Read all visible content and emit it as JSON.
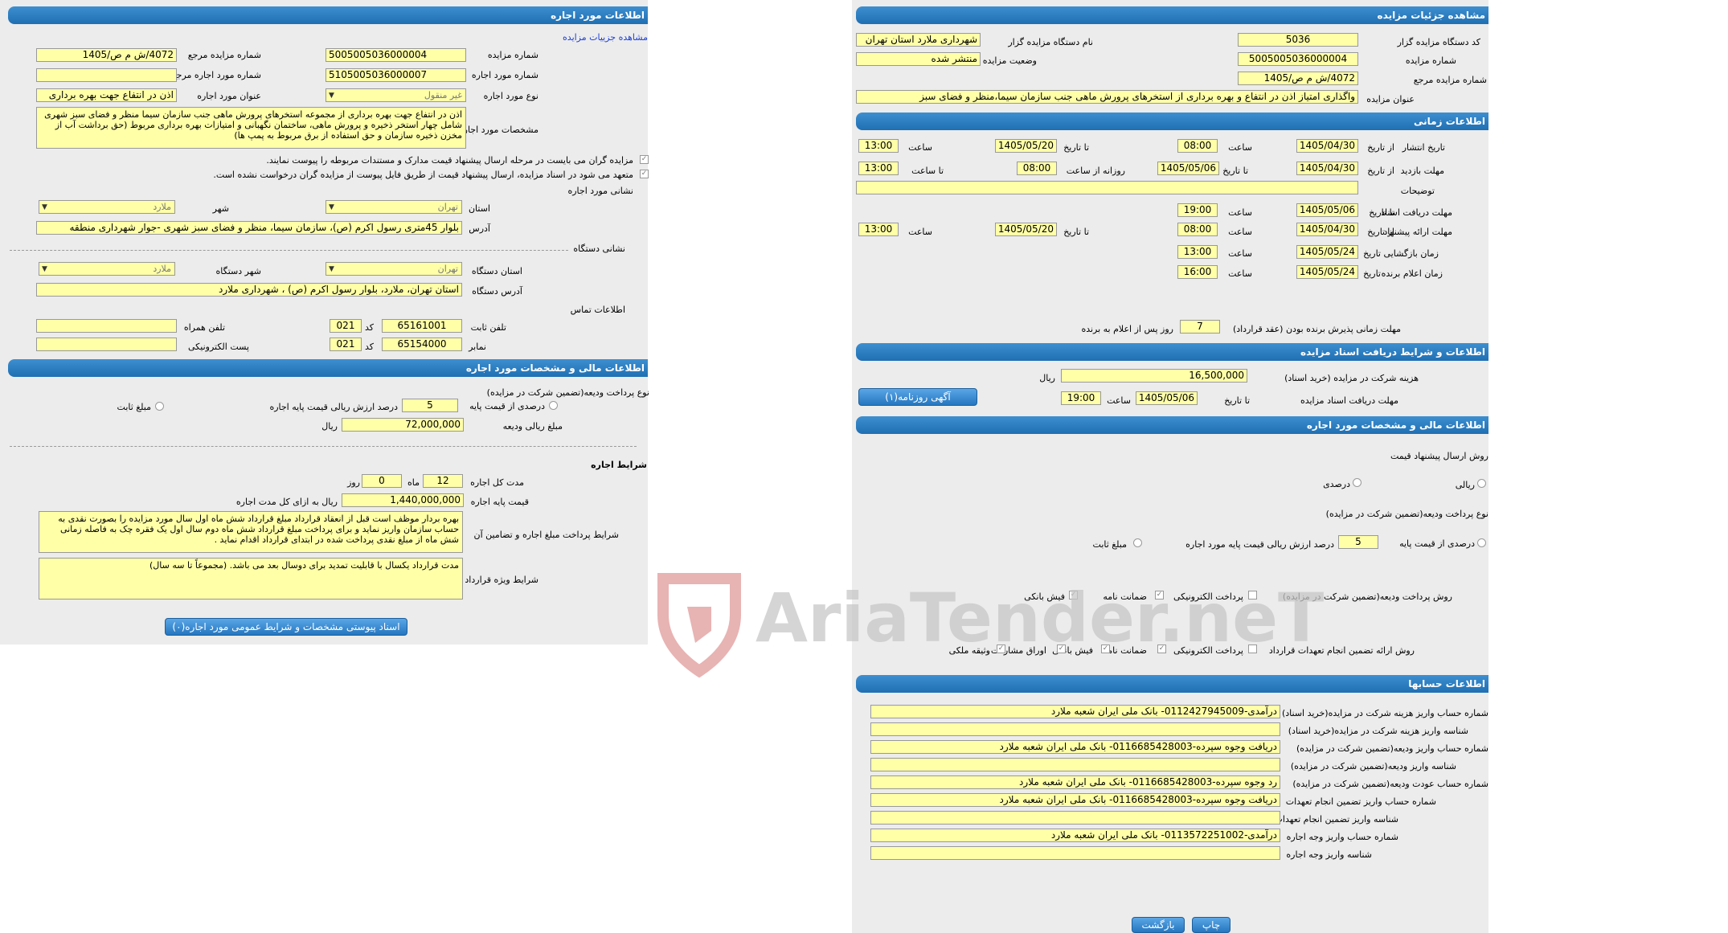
{
  "left": {
    "header": "اطلاعات مورد اجاره",
    "view_details_link": "مشاهده جزییات مزایده",
    "auction_number": {
      "label": "شماره مزایده",
      "value": "5005005036000004"
    },
    "auction_ref_number": {
      "label": "شماره مزایده مرجع",
      "value": "4072/ش م ص/1405"
    },
    "lease_item_number": {
      "label": "شماره مورد اجاره",
      "value": "5105005036000007"
    },
    "lease_ref_number": {
      "label": "شماره مورد اجاره مرجع",
      "value": ""
    },
    "item_type": {
      "label": "نوع مورد اجاره",
      "value": "غیر منقول"
    },
    "item_title": {
      "label": "عنوان مورد اجاره",
      "value": "اذن در انتفاع جهت بهره برداری"
    },
    "item_specs": {
      "label": "مشخصات مورد اجاره",
      "value": "اذن در انتفاع جهت بهره برداری از مجموعه استخرهای پرورش ماهی جنب سازمان سیما منظر و فضای سبز شهری شامل چهار استخر ذخیره و پرورش ماهی، ساختمان نگهبانی و امتیازات بهره برداری مربوط (حق برداشت آب از مخزن ذخیره سازمان و حق استفاده از برق مربوط به پمپ ها)"
    },
    "note1": "مزایده گران می بایست در مرحله ارسال پیشنهاد قیمت مدارک و مستندات مربوطه را پیوست نمایند.",
    "note2": "متعهد می شود در اسناد مزایده، ارسال پیشنهاد قیمت از طریق فایل پیوست از مزایده گران درخواست نشده است.",
    "item_address_title": "نشانی مورد اجاره",
    "province": {
      "label": "استان",
      "value": "تهران"
    },
    "city": {
      "label": "شهر",
      "value": "ملارد"
    },
    "address": {
      "label": "آدرس",
      "value": "بلوار 45متری رسول اکرم (ص)، سازمان سیما، منظر و فضای سبز شهری -جوار شهرداری منطقه"
    },
    "org_address_title": "نشانی دستگاه",
    "org_province": {
      "label": "استان دستگاه",
      "value": "تهران"
    },
    "org_city": {
      "label": "شهر دستگاه",
      "value": "ملارد"
    },
    "org_address": {
      "label": "آدرس دستگاه",
      "value": "استان تهران، ملارد، بلوار رسول اکرم (ص) ، شهرداری ملارد"
    },
    "contact_title": "اطلاعات تماس",
    "phone": {
      "label": "تلفن ثابت",
      "value": "65161001",
      "code_label": "کد",
      "code": "021"
    },
    "mobile": {
      "label": "تلفن همراه",
      "value": ""
    },
    "fax": {
      "label": "نمابر",
      "value": "65154000",
      "code_label": "کد",
      "code": "021"
    },
    "email": {
      "label": "پست الکترونیکی",
      "value": ""
    },
    "financial_header": "اطلاعات مالی و مشخصات مورد اجاره",
    "deposit_method_label": "نوع پرداخت ودیعه(تضمین شرکت در مزایده)",
    "percent_option": "درصدی از قیمت پایه",
    "percent_value": "5",
    "percent_suffix": "درصد ارزش ریالی قیمت پایه اجاره",
    "fixed_option": "مبلغ ثابت",
    "deposit_amount": {
      "label": "مبلغ ریالی ودیعه",
      "value": "72,000,000",
      "unit": "ریال"
    },
    "lease_terms_title": "شرایط اجاره",
    "duration": {
      "label": "مدت کل اجاره",
      "months": "12",
      "months_unit": "ماه",
      "days": "0",
      "days_unit": "روز"
    },
    "base_price": {
      "label": "قیمت پایه اجاره",
      "value": "1,440,000,000",
      "suffix": "ریال به ازای کل مدت اجاره"
    },
    "payment_terms": {
      "label": "شرایط پرداخت مبلغ اجاره و تضامین آن",
      "value": "بهره بردار موظف است قبل از انعقاد قرارداد مبلغ قرارداد شش ماه اول سال مورد مزایده را بصورت نقدی به حساب سازمان واریز نماید و برای پرداخت مبلغ قرارداد شش ماه دوم سال اول یک فقره چک به فاصله زمانی شش ماه از مبلغ نقدی پرداخت شده در ابتدای قرارداد اقدام نماید ."
    },
    "special_terms": {
      "label": "شرایط ویژه قرارداد",
      "value": "مدت قرارداد یکسال با قابلیت تمدید برای دوسال بعد می باشد. (مجموعاً تا سه سال)"
    },
    "attachments_button": "اسناد پیوستی مشخصات و شرایط عمومی مورد اجاره(۰)"
  },
  "right": {
    "header": "مشاهده جزئیات مزایده",
    "org_code": {
      "label": "کد دستگاه مزایده گزار",
      "value": "5036"
    },
    "org_name": {
      "label": "نام دستگاه مزایده گزار",
      "value": "شهرداری ملارد استان تهران"
    },
    "auction_number": {
      "label": "شماره مزایده",
      "value": "5005005036000004"
    },
    "status": {
      "label": "وضعیت مزایده",
      "value": "منتشر شده"
    },
    "ref_number": {
      "label": "شماره مزایده مرجع",
      "value": "4072/ش م ص/1405"
    },
    "title": {
      "label": "عنوان مزایده",
      "value": "واگذاری امتیاز اذن در انتفاع و بهره برداری از استخرهای پرورش ماهی جنب سازمان سیما،منظر و فضای سبز"
    },
    "time_header": "اطلاعات زمانی",
    "publish": {
      "label": "تاریخ انتشار",
      "from_label": "از تاریخ",
      "from_date": "1405/04/30",
      "from_time_label": "ساعت",
      "from_time": "08:00",
      "to_label": "تا تاریخ",
      "to_date": "1405/05/20",
      "to_time_label": "ساعت",
      "to_time": "13:00"
    },
    "visit": {
      "label": "مهلت بازدید",
      "from_label": "از تاریخ",
      "from_date": "1405/04/30",
      "to_label": "تا تاریخ",
      "to_date": "1405/05/06",
      "daily_label": "روزانه از ساعت",
      "daily_from": "08:00",
      "daily_to_label": "تا ساعت",
      "daily_to": "13:00"
    },
    "description": {
      "label": "توضیحات",
      "value": ""
    },
    "doc_receive": {
      "label": "مهلت دریافت اسناد",
      "to_label": "تا تاریخ",
      "to_date": "1405/05/06",
      "time_label": "ساعت",
      "time": "19:00"
    },
    "offer_submit": {
      "label": "مهلت ارائه پیشنهاد",
      "from_label": "از تاریخ",
      "from_date": "1405/04/30",
      "from_time_label": "ساعت",
      "from_time": "08:00",
      "to_label": "تا تاریخ",
      "to_date": "1405/05/20",
      "to_time_label": "ساعت",
      "to_time": "13:00"
    },
    "opening": {
      "label": "زمان بازگشایی",
      "date_label": "تاریخ",
      "date": "1405/05/24",
      "time_label": "ساعت",
      "time": "13:00"
    },
    "winner_announce": {
      "label": "زمان اعلام برنده",
      "date_label": "تاریخ",
      "date": "1405/05/24",
      "time_label": "ساعت",
      "time": "16:00"
    },
    "acceptance": {
      "label": "مهلت زمانی پذیرش برنده بودن (عقد قرارداد)",
      "value": "7",
      "suffix": "روز پس از اعلام به برنده"
    },
    "docs_header": "اطلاعات و شرایط دریافت اسناد مزایده",
    "doc_fee": {
      "label": "هزینه شرکت در مزایده (خرید اسناد)",
      "value": "16,500,000",
      "unit": "ریال"
    },
    "doc_deadline": {
      "label": "مهلت دریافت اسناد مزایده",
      "to_label": "تا تاریخ",
      "date": "1405/05/06",
      "time_label": "ساعت",
      "time": "19:00"
    },
    "newspaper_button": "آگهی روزنامه(۱)",
    "financial_header": "اطلاعات مالی و مشخصات مورد اجاره",
    "price_method_label": "روش ارسال پیشنهاد قیمت",
    "rial_option": "ریالی",
    "percent_option": "درصدی",
    "deposit_type_label": "نوع پرداخت ودیعه(تضمین شرکت در مزایده)",
    "deposit_percent_option": "درصدی از قیمت پایه",
    "deposit_percent_value": "5",
    "deposit_percent_suffix": "درصد ارزش ریالی قیمت پایه مورد اجاره",
    "deposit_fixed_option": "مبلغ ثابت",
    "deposit_pay_method": {
      "label": "روش پرداخت ودیعه(تضمین شرکت در مزایده)",
      "options": [
        "پرداخت الکترونیکی",
        "ضمانت نامه",
        "فیش بانکی"
      ]
    },
    "guarantee_method": {
      "label": "روش ارائه تضمین انجام تعهدات قرارداد",
      "options": [
        "پرداخت الکترونیکی",
        "ضمانت نامه",
        "فیش بانکی",
        "اوراق مشارکت",
        "وثیقه ملکی"
      ]
    },
    "accounts_header": "اطلاعات حسابها",
    "accounts": [
      {
        "label": "شماره حساب واریز هزینه شرکت در مزایده(خرید اسناد)",
        "value": "درآمدی-0112427945009- بانک ملی ایران شعبه ملارد"
      },
      {
        "label": "شناسه واریز هزینه شرکت در مزایده(خرید اسناد)",
        "value": ""
      },
      {
        "label": "شماره حساب واریز ودیعه(تضمین شرکت در مزایده)",
        "value": "دریافت وجوه سپرده-0116685428003- بانک ملی ایران شعبه ملارد"
      },
      {
        "label": "شناسه واریز ودیعه(تضمین شرکت در مزایده)",
        "value": ""
      },
      {
        "label": "شماره حساب عودت ودیعه(تضمین شرکت در مزایده)",
        "value": "رد وجوه سپرده-0116685428003- بانک ملی ایران شعبه ملارد"
      },
      {
        "label": "شماره حساب واریز تضمین انجام تعهدات",
        "value": "دریافت وجوه سپرده-0116685428003- بانک ملی ایران شعبه ملارد"
      },
      {
        "label": "شناسه واریز تضمین انجام تعهدات",
        "value": ""
      },
      {
        "label": "شماره حساب واریز وجه اجاره",
        "value": "درآمدی-0113572251002- بانک ملی ایران شعبه ملارد"
      },
      {
        "label": "شناسه واریز وجه اجاره",
        "value": ""
      }
    ],
    "print_button": "چاپ",
    "back_button": "بازگشت"
  },
  "watermark": "AriaTender.neT",
  "colors": {
    "header_blue": "#2a7fc4",
    "field_yellow": "#ffffa8",
    "panel_gray": "#ececec",
    "link_blue": "#1a3fd6"
  }
}
